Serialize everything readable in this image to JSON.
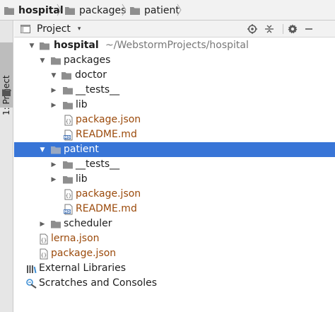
{
  "breadcrumb": [
    {
      "label": "hospital"
    },
    {
      "label": "packages"
    },
    {
      "label": "patient"
    }
  ],
  "tool_stripe": {
    "label": "1: Project"
  },
  "panel": {
    "view_label": "Project",
    "dropdown_caret": "▾",
    "actions": [
      "locate-icon",
      "collapse-all-icon",
      "gear-icon",
      "minimize-icon"
    ]
  },
  "tree": {
    "root": {
      "label": "hospital",
      "path": "~/WebstormProjects/hospital"
    },
    "packages": {
      "label": "packages"
    },
    "doctor": {
      "label": "doctor",
      "tests": "__tests__",
      "lib": "lib",
      "package_json": "package.json",
      "readme": "README.md"
    },
    "patient": {
      "label": "patient",
      "tests": "__tests__",
      "lib": "lib",
      "package_json": "package.json",
      "readme": "README.md"
    },
    "scheduler": {
      "label": "scheduler"
    },
    "lerna_json": "lerna.json",
    "root_package_json": "package.json",
    "external_libraries": "External Libraries",
    "scratches": "Scratches and Consoles"
  },
  "colors": {
    "selection": "#3875d7",
    "folder": "#8e8e8e",
    "modified_file": "#9b4a0b",
    "background": "#ffffff",
    "toolbar": "#f2f2f2"
  },
  "icons": {
    "expanded": "▼",
    "collapsed": "▶"
  }
}
